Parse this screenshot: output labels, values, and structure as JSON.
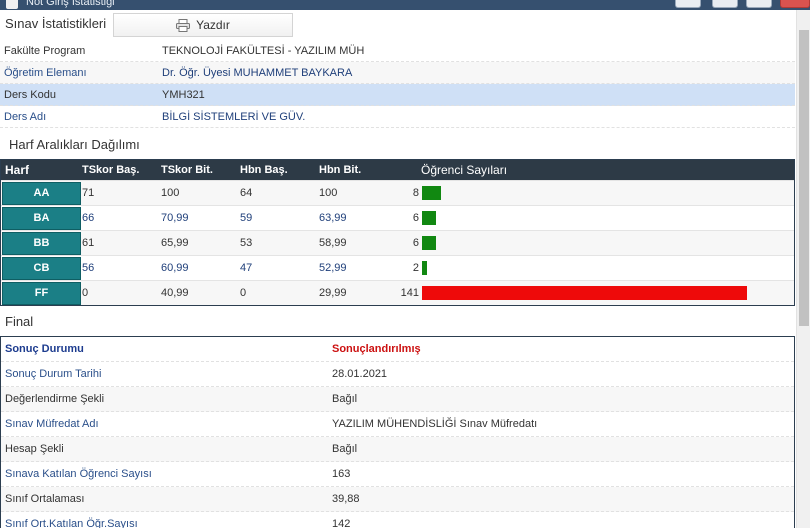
{
  "window": {
    "title": "Not Giriş İstatistiği",
    "controls": [
      "help-icon",
      "minimize-icon",
      "maximize-icon",
      "close-icon"
    ]
  },
  "header": {
    "title": "Sınav İstatistikleri",
    "print_label": "Yazdır",
    "print_icon": "printer-icon"
  },
  "info": [
    {
      "label": "Fakülte Program",
      "value": "TEKNOLOJİ FAKÜLTESİ - YAZILIM MÜH"
    },
    {
      "label": "Öğretim Elemanı",
      "value": "Dr. Öğr. Üyesi MUHAMMET BAYKARA"
    },
    {
      "label": "Ders Kodu",
      "value": "YMH321"
    },
    {
      "label": "Ders Adı",
      "value": "BİLGİ SİSTEMLERİ VE GÜV."
    }
  ],
  "distribution": {
    "title": "Harf Aralıkları Dağılımı",
    "headers": [
      "Harf",
      "TSkor Baş.",
      "TSkor Bit.",
      "Hbn Baş.",
      "Hbn Bit.",
      "Öğrenci Sayıları"
    ],
    "rows": [
      {
        "harf": "AA",
        "tskor_bas": "71",
        "tskor_bit": "100",
        "hbn_bas": "64",
        "hbn_bit": "100",
        "count": 8
      },
      {
        "harf": "BA",
        "tskor_bas": "66",
        "tskor_bit": "70,99",
        "hbn_bas": "59",
        "hbn_bit": "63,99",
        "count": 6
      },
      {
        "harf": "BB",
        "tskor_bas": "61",
        "tskor_bit": "65,99",
        "hbn_bas": "53",
        "hbn_bit": "58,99",
        "count": 6
      },
      {
        "harf": "CB",
        "tskor_bas": "56",
        "tskor_bit": "60,99",
        "hbn_bas": "47",
        "hbn_bit": "52,99",
        "count": 2
      },
      {
        "harf": "FF",
        "tskor_bas": "0",
        "tskor_bit": "40,99",
        "hbn_bas": "0",
        "hbn_bit": "29,99",
        "count": 141
      }
    ],
    "bar_colors": {
      "pass": "#118811",
      "fail": "#ee0a0a"
    }
  },
  "final": {
    "title": "Final",
    "rows": [
      {
        "label": "Sonuç Durumu",
        "value": "Sonuçlandırılmış"
      },
      {
        "label": "Sonuç Durum Tarihi",
        "value": "28.01.2021"
      },
      {
        "label": "Değerlendirme Şekli",
        "value": "Bağıl"
      },
      {
        "label": "Sınav Müfredat Adı",
        "value": "YAZILIM MÜHENDİSLİĞİ Sınav Müfredatı"
      },
      {
        "label": "Hesap Şekli",
        "value": "Bağıl"
      },
      {
        "label": "Sınava Katılan Öğrenci Sayısı",
        "value": "163"
      },
      {
        "label": "Sınıf Ortalaması",
        "value": "39,88"
      },
      {
        "label": "Sınıf Ort.Katılan Öğr.Sayısı",
        "value": "142"
      }
    ]
  }
}
